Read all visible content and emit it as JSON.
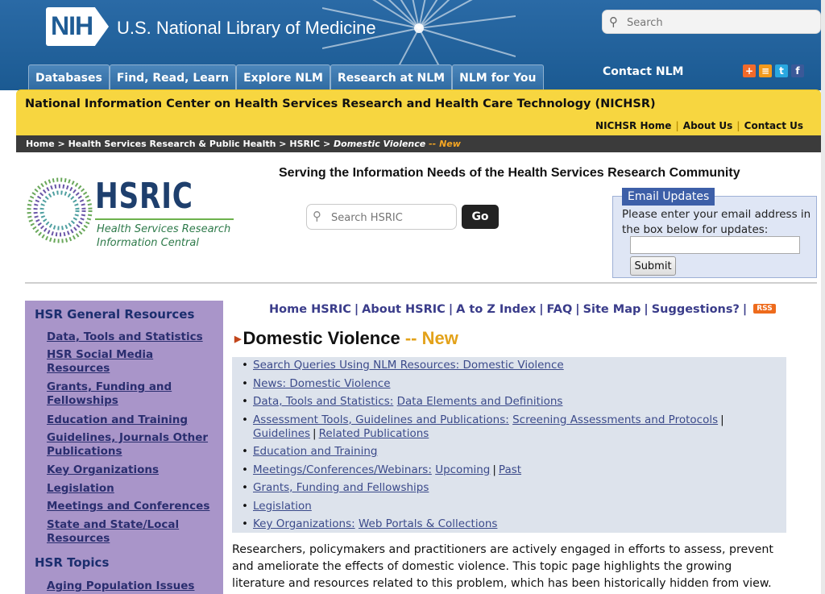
{
  "header": {
    "logo": "NIH",
    "site_title": "U.S. National Library of Medicine",
    "search_placeholder": "Search",
    "tabs": [
      "Databases",
      "Find, Read, Learn",
      "Explore NLM",
      "Research at NLM",
      "NLM for You"
    ],
    "contact": "Contact NLM",
    "social_icons": [
      "add-this-icon",
      "rss-icon",
      "twitter-icon",
      "facebook-icon"
    ]
  },
  "nichsr": {
    "title": "National Information Center on Health Services Research and Health Care Technology (NICHSR)",
    "links": [
      "NICHSR Home",
      "About Us",
      "Contact Us"
    ]
  },
  "breadcrumb": {
    "items": [
      "Home",
      "Health Services Research & Public Health",
      "HSRIC"
    ],
    "current": "Domestic Violence",
    "new_label": "New"
  },
  "hsric": {
    "logo_text": "HSRIC",
    "logo_sub1": "Health Services Research",
    "logo_sub2": "Information Central",
    "tagline": "Serving the Information Needs of the Health Services Research Community",
    "search_placeholder": "Search HSRIC",
    "go_label": "Go"
  },
  "email": {
    "tab": "Email Updates",
    "text": "Please enter your email address in the box below for updates:",
    "submit": "Submit"
  },
  "sidebar": {
    "heading1": "HSR General Resources",
    "links1": [
      "Data, Tools and Statistics",
      "HSR Social Media Resources",
      "Grants, Funding and Fellowships",
      "Education and Training",
      "Guidelines, Journals Other Publications",
      "Key Organizations",
      "Legislation",
      "Meetings and Conferences",
      "State and State/Local Resources"
    ],
    "heading2": "HSR Topics",
    "links2": [
      "Aging Population Issues"
    ]
  },
  "toplinks": [
    "Home HSRIC",
    "About HSRIC",
    "A to Z Index",
    "FAQ",
    "Site Map",
    "Suggestions?"
  ],
  "rss_label": "RSS",
  "page": {
    "title": "Domestic Violence",
    "dash": "--",
    "new_label": "New"
  },
  "links": {
    "l1": "Search Queries Using NLM Resources: Domestic Violence",
    "l2": "News: Domestic Violence",
    "l3a": "Data, Tools and Statistics:",
    "l3b": "Data Elements and Definitions",
    "l4a": "Assessment Tools, Guidelines and Publications:",
    "l4b": "Screening Assessments and Protocols",
    "l4c": "Guidelines",
    "l4d": "Related Publications",
    "l5": "Education and Training",
    "l6a": "Meetings/Conferences/Webinars:",
    "l6b": "Upcoming",
    "l6c": "Past",
    "l7": "Grants, Funding and Fellowships",
    "l8": "Legislation",
    "l9a": "Key Organizations:",
    "l9b": "Web Portals & Collections"
  },
  "description": "Researchers, policymakers and practitioners are actively engaged in efforts to assess, prevent and ameliorate the effects of domestic violence. This topic page highlights the growing literature and resources related to this problem, which has been historically hidden from view."
}
